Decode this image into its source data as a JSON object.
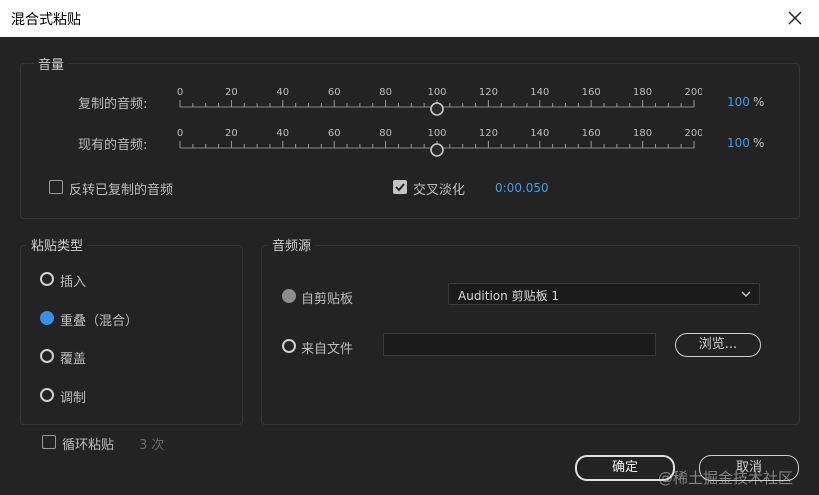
{
  "window": {
    "title": "混合式粘贴"
  },
  "volume": {
    "title": "音量",
    "copied_label": "复制的音频:",
    "existing_label": "现有的音频:",
    "ticks": [
      "0",
      "20",
      "40",
      "60",
      "80",
      "100",
      "120",
      "140",
      "160",
      "180",
      "200"
    ],
    "copied_value": 100,
    "existing_value": 100,
    "copied_value_text": "100",
    "existing_value_text": "100",
    "unit": "%",
    "invert_label": "反转已复制的音频",
    "invert_checked": false,
    "crossfade_label": "交叉淡化",
    "crossfade_checked": true,
    "crossfade_time": "0:00.050"
  },
  "paste_type": {
    "title": "粘贴类型",
    "options": [
      "插入",
      "重叠（混合）",
      "覆盖",
      "调制"
    ],
    "selected_index": 1
  },
  "source": {
    "title": "音频源",
    "clipboard_label": "自剪贴板",
    "clipboard_value": "Audition 剪贴板 1",
    "file_label": "来自文件",
    "file_path": "",
    "browse_label": "浏览..."
  },
  "loop": {
    "label": "循环粘贴",
    "count": "3 次",
    "checked": false
  },
  "buttons": {
    "ok": "确定",
    "cancel": "取消"
  },
  "watermark": "@稀土掘金技术社区",
  "colors": {
    "accent": "#3a8ee6",
    "value_text": "#3d9fe8"
  }
}
